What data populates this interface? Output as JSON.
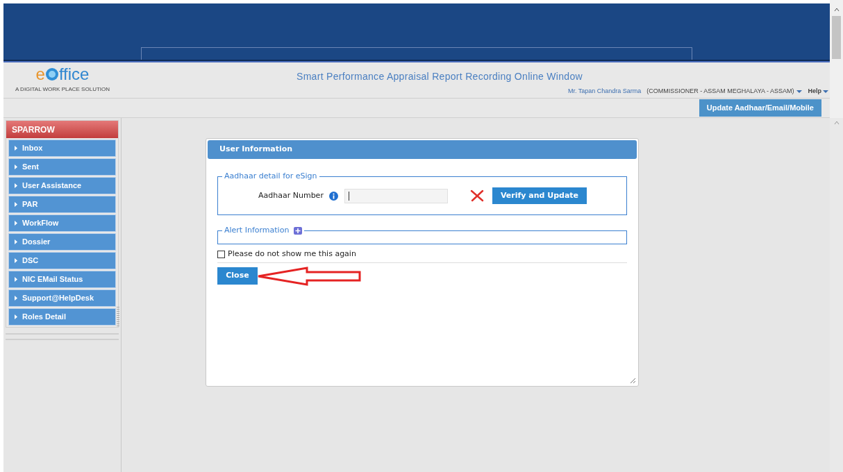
{
  "logo": {
    "text_start": "e",
    "text_end": "ffice",
    "tagline": "A DIGITAL WORK PLACE SOLUTION"
  },
  "header": {
    "title": "Smart Performance Appraisal Report Recording Online Window",
    "user_name": "Mr. Tapan Chandra Sarma",
    "role": "(COMMISSIONER - ASSAM MEGHALAYA - ASSAM)",
    "help": "Help"
  },
  "toolbar": {
    "update_button": "Update Aadhaar/Email/Mobile"
  },
  "sidebar": {
    "title": "SPARROW",
    "items": [
      {
        "label": "Inbox"
      },
      {
        "label": "Sent"
      },
      {
        "label": "User Assistance"
      },
      {
        "label": "PAR"
      },
      {
        "label": "WorkFlow"
      },
      {
        "label": "Dossier"
      },
      {
        "label": "DSC"
      },
      {
        "label": "NIC EMail Status"
      },
      {
        "label": "Support@HelpDesk"
      },
      {
        "label": "Roles Detail"
      }
    ]
  },
  "dialog": {
    "title": "User Information",
    "aadhaar_legend": "Aadhaar detail for eSign",
    "aadhaar_label": "Aadhaar Number",
    "verify_button": "Verify and Update",
    "alert_legend": "Alert Information",
    "checkbox": {
      "label": "Please do not show me this again",
      "checked": false
    },
    "close_button": "Close"
  }
}
